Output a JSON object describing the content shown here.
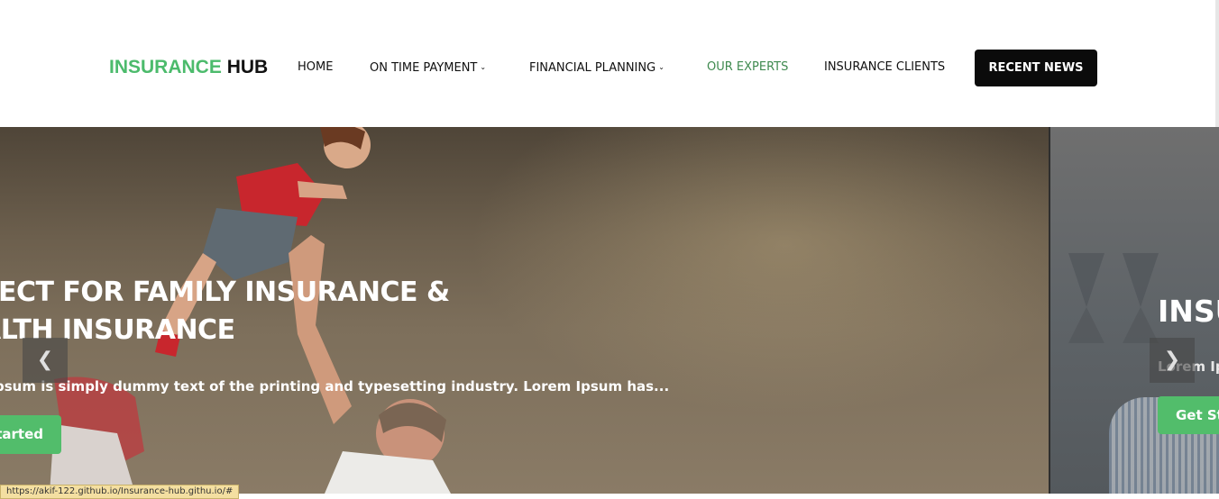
{
  "brand": {
    "part1": "INSURANCE",
    "part2": "HUB",
    "accent_color": "#4cbb6c"
  },
  "nav": {
    "items": [
      {
        "label": "HOME"
      },
      {
        "label": "ON TIME PAYMENT",
        "dropdown": true
      },
      {
        "label": "FINANCIAL PLANNING",
        "dropdown": true
      },
      {
        "label": "OUR EXPERTS",
        "active": true
      },
      {
        "label": "INSURANCE CLIENTS"
      }
    ],
    "caret": "chevron-down-icon",
    "cta_label": "RECENT NEWS"
  },
  "hero": {
    "current": {
      "title_line1": "FECT FOR FAMILY INSURANCE &",
      "title_line2": "ALTH INSURANCE",
      "description": "psum is simply dummy text of the printing and typesetting industry. Lorem Ipsum has...",
      "button_label": "tarted"
    },
    "next": {
      "title": "INSU",
      "description": "Lorem Ip",
      "button_label": "Get St"
    },
    "prev_arrow": "❮",
    "next_arrow": "❯"
  },
  "status_bar": {
    "url": "https://akif-122.github.io/Insurance-hub.githu.io/#"
  }
}
